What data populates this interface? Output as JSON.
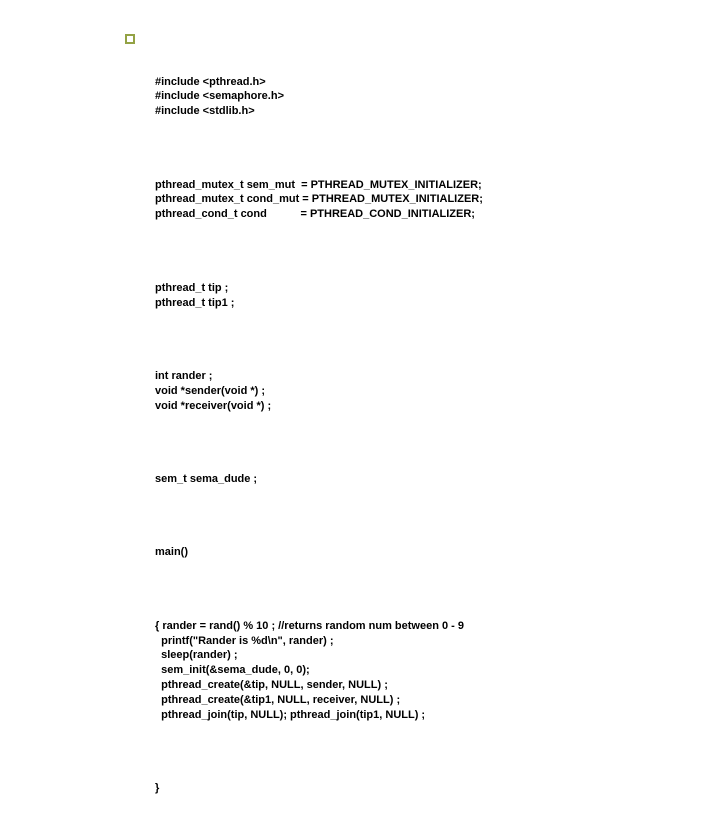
{
  "code": {
    "b1_l1": "#include <pthread.h>",
    "b1_l2": "#include <semaphore.h>",
    "b1_l3": "#include <stdlib.h>",
    "b2_l1": "pthread_mutex_t sem_mut  = PTHREAD_MUTEX_INITIALIZER;",
    "b2_l2": "pthread_mutex_t cond_mut = PTHREAD_MUTEX_INITIALIZER;",
    "b2_l3": "pthread_cond_t cond           = PTHREAD_COND_INITIALIZER;",
    "b3_l1": "pthread_t tip ;",
    "b3_l2": "pthread_t tip1 ;",
    "b4_l1": "int rander ;",
    "b4_l2": "void *sender(void *) ;",
    "b4_l3": "void *receiver(void *) ;",
    "b5_l1": "sem_t sema_dude ;",
    "b6_l1": "main()",
    "b7_l1": "{ rander = rand() % 10 ; //returns random num between 0 - 9",
    "b7_l2": "  printf(\"Rander is %d\\n\", rander) ;",
    "b7_l3": "  sleep(rander) ;",
    "b7_l4": "  sem_init(&sema_dude, 0, 0);",
    "b7_l5": "  pthread_create(&tip, NULL, sender, NULL) ;",
    "b7_l6": "  pthread_create(&tip1, NULL, receiver, NULL) ;",
    "b7_l7": "  pthread_join(tip, NULL); pthread_join(tip1, NULL) ;",
    "b8_l1": "}"
  }
}
